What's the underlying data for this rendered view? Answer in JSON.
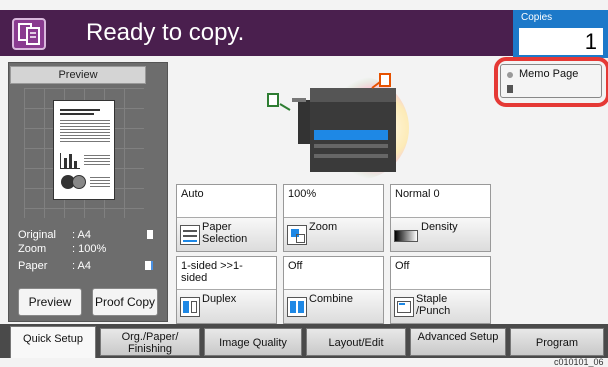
{
  "header": {
    "status": "Ready to copy.",
    "copies_label": "Copies",
    "copies_value": "1",
    "icon": "copy-icon"
  },
  "preview": {
    "title": "Preview",
    "original_label": "Original",
    "original_value": ": A4",
    "zoom_label": "Zoom",
    "zoom_value": ": 100%",
    "paper_label": "Paper",
    "paper_value": ": A4",
    "preview_button": "Preview",
    "proof_copy_button": "Proof Copy"
  },
  "memo": {
    "label": "Memo Page",
    "highlight_color": "#e53935"
  },
  "tiles": [
    {
      "value": "Auto",
      "button": "Paper Selection",
      "icon": "paper-icon"
    },
    {
      "value": "100%",
      "button": "Zoom",
      "icon": "zoom-icon"
    },
    {
      "value": "Normal 0",
      "button": "Density",
      "icon": "density-icon"
    },
    {
      "value": "1-sided >>1-sided",
      "button": "Duplex",
      "icon": "duplex-icon"
    },
    {
      "value": "Off",
      "button": "Combine",
      "icon": "combine-icon"
    },
    {
      "value": "Off",
      "button": "Staple /Punch",
      "icon": "staple-icon"
    }
  ],
  "tabs": [
    "Quick Setup",
    "Org./Paper/ Finishing",
    "Image Quality",
    "Layout/Edit",
    "Advanced Setup",
    "Program"
  ],
  "figure_code": "c010101_06",
  "colors": {
    "header": "#4a1f4e",
    "copies_box": "#1d79c9"
  }
}
